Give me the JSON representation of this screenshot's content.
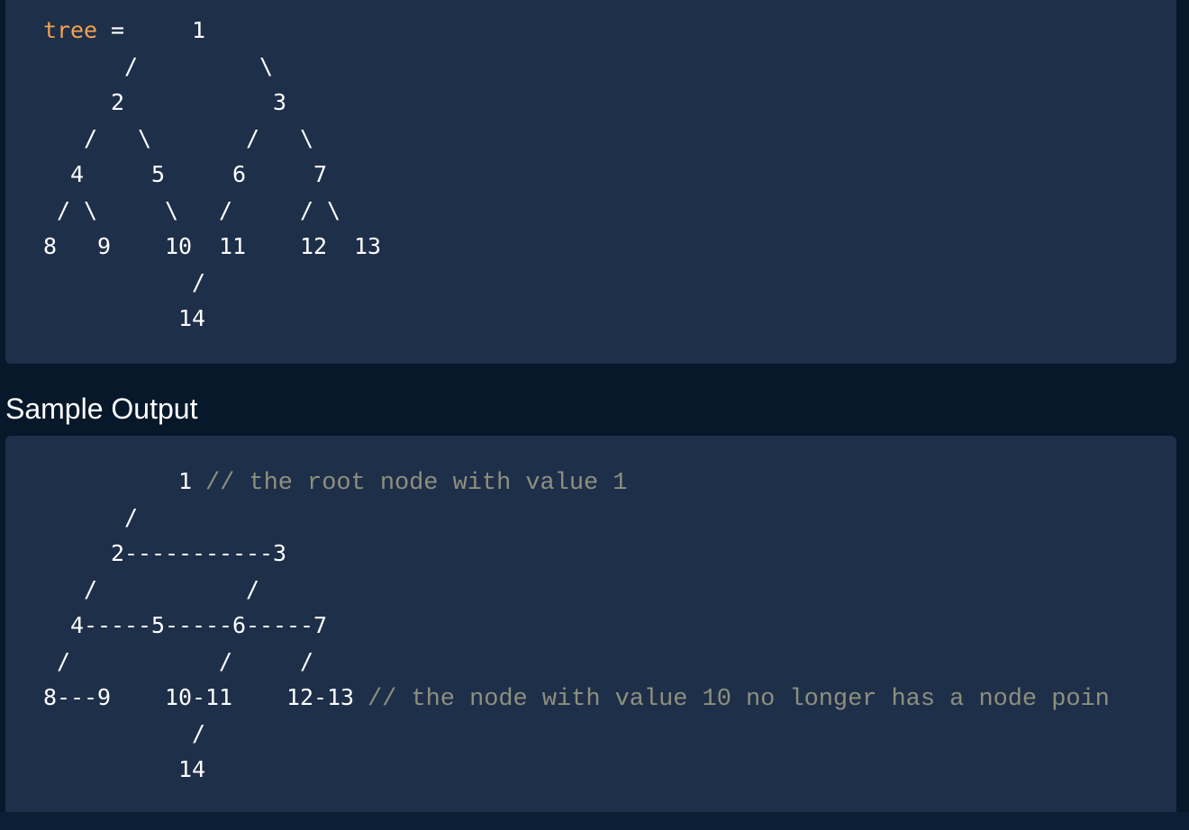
{
  "sample_input": {
    "first_line": {
      "keyword": "tree",
      "rest": " =     1"
    },
    "lines": [
      "      /         \\",
      "     2           3",
      "   /   \\       /   \\",
      "  4     5     6     7",
      " / \\     \\   /     / \\",
      "8   9    10  11    12  13",
      "           /",
      "          14"
    ]
  },
  "sample_output_heading": "Sample Output",
  "sample_output": {
    "lines": [
      {
        "code": "          1 ",
        "comment": "// the root node with value 1"
      },
      {
        "code": "      /",
        "comment": ""
      },
      {
        "code": "     2-----------3",
        "comment": ""
      },
      {
        "code": "   /           /",
        "comment": ""
      },
      {
        "code": "  4-----5-----6-----7",
        "comment": ""
      },
      {
        "code": " /           /     /",
        "comment": ""
      },
      {
        "code": "8---9    10-11    12-13 ",
        "comment": "// the node with value 10 no longer has a node poin"
      },
      {
        "code": "           /",
        "comment": ""
      },
      {
        "code": "          14",
        "comment": ""
      }
    ]
  }
}
